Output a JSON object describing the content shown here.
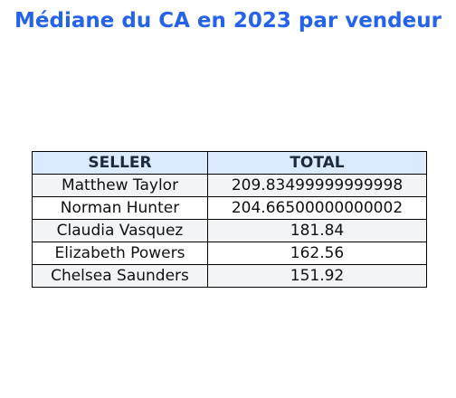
{
  "chart_data": {
    "type": "table",
    "title": "Médiane du CA en 2023 par vendeur",
    "columns": [
      "SELLER",
      "TOTAL"
    ],
    "rows": [
      [
        "Matthew Taylor",
        "209.83499999999998"
      ],
      [
        "Norman Hunter",
        "204.66500000000002"
      ],
      [
        "Claudia Vasquez",
        "181.84"
      ],
      [
        "Elizabeth Powers",
        "162.56"
      ],
      [
        "Chelsea Saunders",
        "151.92"
      ]
    ]
  },
  "colors": {
    "title": "#2563eb",
    "header_background": "#dbeafe",
    "row_shaded": "#f3f4f6",
    "row_plain": "#ffffff",
    "border": "#000000"
  }
}
